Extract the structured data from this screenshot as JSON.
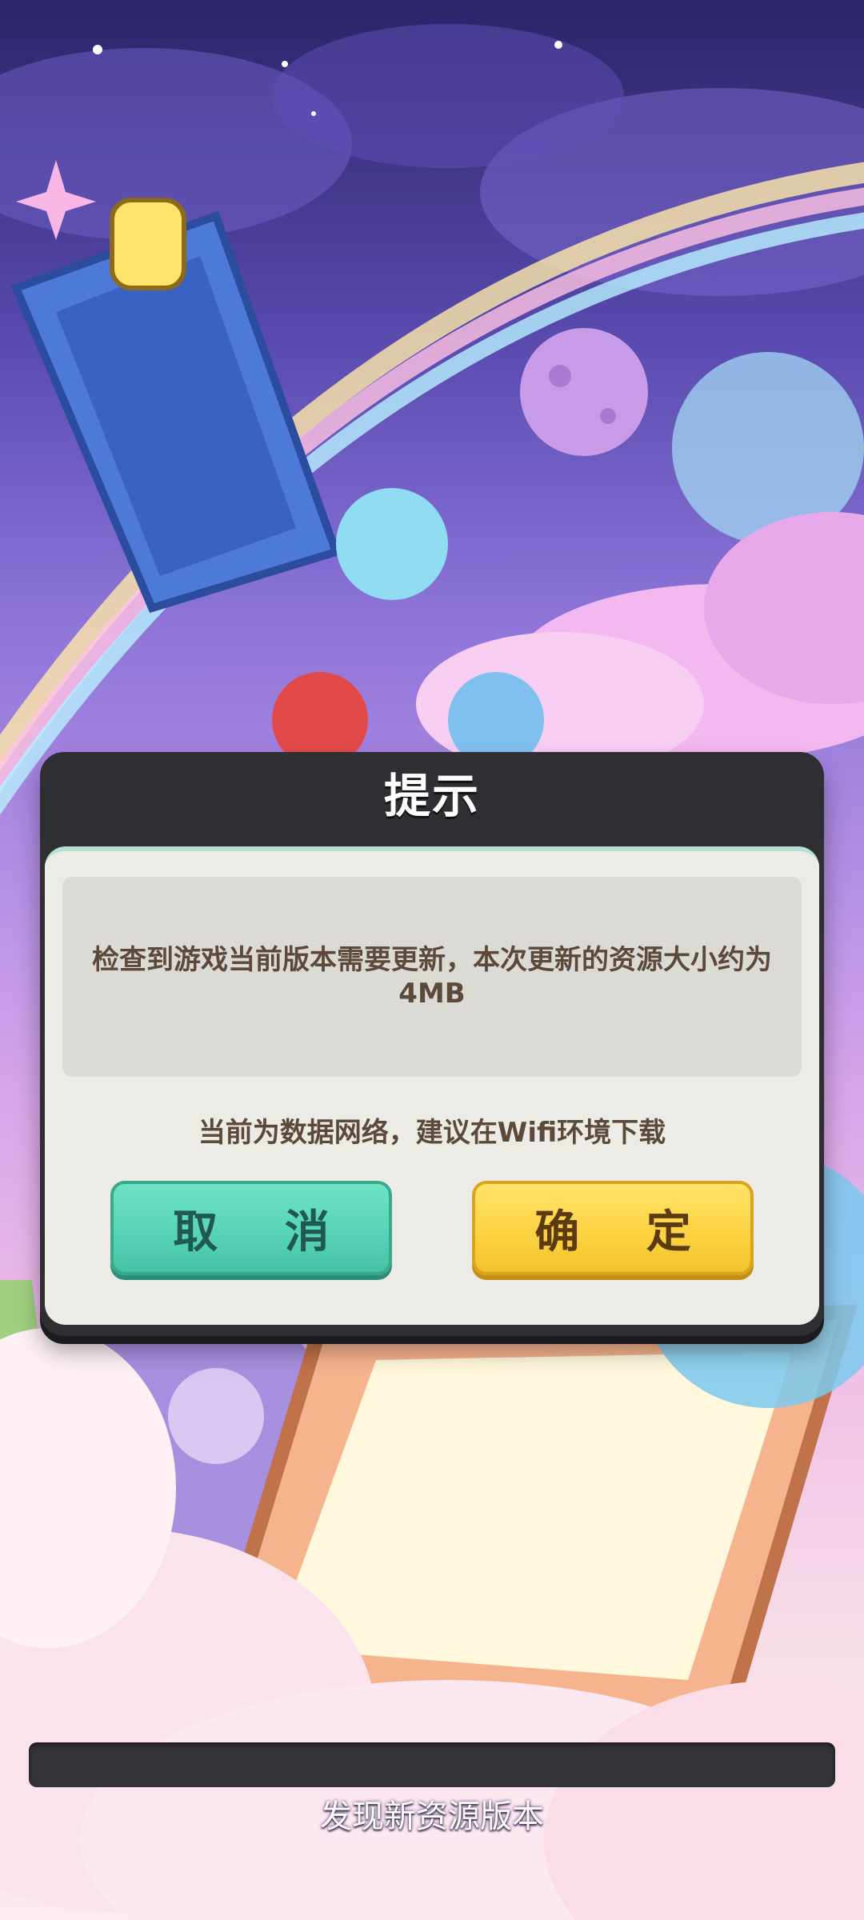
{
  "dialog": {
    "title": "提示",
    "message": "检查到游戏当前版本需要更新，本次更新的资源大小约为4MB",
    "network_hint": "当前为数据网络，建议在Wifi环境下载",
    "cancel_label": "取 消",
    "confirm_label": "确 定"
  },
  "loading": {
    "status": "发现新资源版本",
    "progress": 0
  },
  "colors": {
    "cancel_button": "#55d3b4",
    "confirm_button": "#fcd23f",
    "dialog_header": "#2e2e33",
    "dialog_body": "#ecebe6",
    "text": "#5b4a3c"
  }
}
